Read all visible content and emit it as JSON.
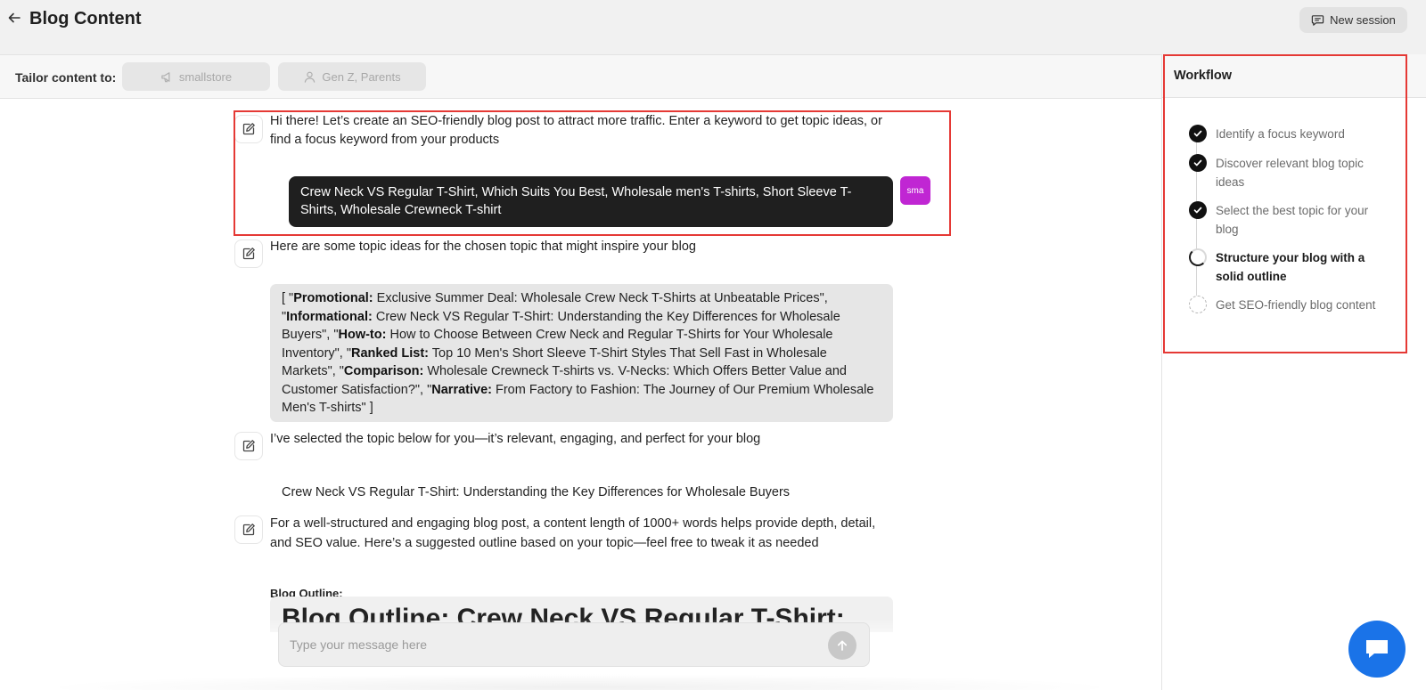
{
  "header": {
    "title": "Blog Content",
    "back_icon": "arrow-left-icon",
    "new_session_label": "New session",
    "new_session_icon": "chat-bubble-icon"
  },
  "tailor": {
    "label": "Tailor content to:",
    "chips": [
      {
        "icon": "megaphone-icon",
        "label": "smallstore"
      },
      {
        "icon": "user-icon",
        "label": "Gen Z, Parents"
      }
    ]
  },
  "chat": {
    "messages": [
      {
        "text": "Hi there! Let’s create an SEO-friendly blog post to attract more traffic. Enter a keyword to get topic ideas, or find a focus keyword from your products"
      },
      {
        "text": "Here are some topic ideas for the chosen topic that might inspire your blog"
      },
      {
        "text": "I’ve selected the topic below for you—it’s relevant, engaging, and perfect for your blog"
      },
      {
        "text": "For a well-structured and engaging blog post, a content length of 1000+ words helps provide depth, detail, and SEO value. Here’s a suggested outline based on your topic—feel free to tweak it as needed"
      }
    ],
    "user_reply": "Crew Neck VS Regular T-Shirt, Which Suits You Best, Wholesale men's T-shirts, Short Sleeve T-Shirts, Wholesale Crewneck T-shirt",
    "user_avatar": "sma",
    "topic_ideas": {
      "open": "[ \"",
      "items": [
        {
          "tag": "Promotional:",
          "text": " Exclusive Summer Deal: Wholesale Crew Neck T-Shirts at Unbeatable Prices\", \""
        },
        {
          "tag": "Informational:",
          "text": " Crew Neck VS Regular T-Shirt: Understanding the Key Differences for Wholesale Buyers\", \""
        },
        {
          "tag": "How-to:",
          "text": " How to Choose Between Crew Neck and Regular T-Shirts for Your Wholesale Inventory\", \""
        },
        {
          "tag": "Ranked List:",
          "text": " Top 10 Men's Short Sleeve T-Shirt Styles That Sell Fast in Wholesale Markets\", \""
        },
        {
          "tag": "Comparison:",
          "text": " Wholesale Crewneck T-shirts vs. V-Necks: Which Offers Better Value and Customer Satisfaction?\", \""
        },
        {
          "tag": "Narrative:",
          "text": " From Factory to Fashion: The Journey of Our Premium Wholesale Men's T-shirts\" ]"
        }
      ]
    },
    "selected_topic": "Crew Neck VS Regular T-Shirt: Understanding the Key Differences for Wholesale Buyers",
    "outline_label": "Blog Outline:",
    "outline_heading": "Blog Outline: Crew Neck VS Regular T-Shirt:"
  },
  "composer": {
    "placeholder": "Type your message here",
    "send_icon": "arrow-up-icon"
  },
  "workflow": {
    "title": "Workflow",
    "steps": [
      {
        "label": "Identify a focus keyword",
        "status": "done"
      },
      {
        "label": "Discover relevant blog topic ideas",
        "status": "done"
      },
      {
        "label": "Select the best topic for your blog",
        "status": "done"
      },
      {
        "label": "Structure your blog with a solid outline",
        "status": "in-progress"
      },
      {
        "label": "Get SEO-friendly blog content",
        "status": "pending"
      }
    ]
  },
  "colors": {
    "accent_blue": "#1a73e8",
    "avatar_magenta": "#c026d3",
    "highlight_red": "#e53935",
    "user_bubble": "#1f1f1f"
  }
}
